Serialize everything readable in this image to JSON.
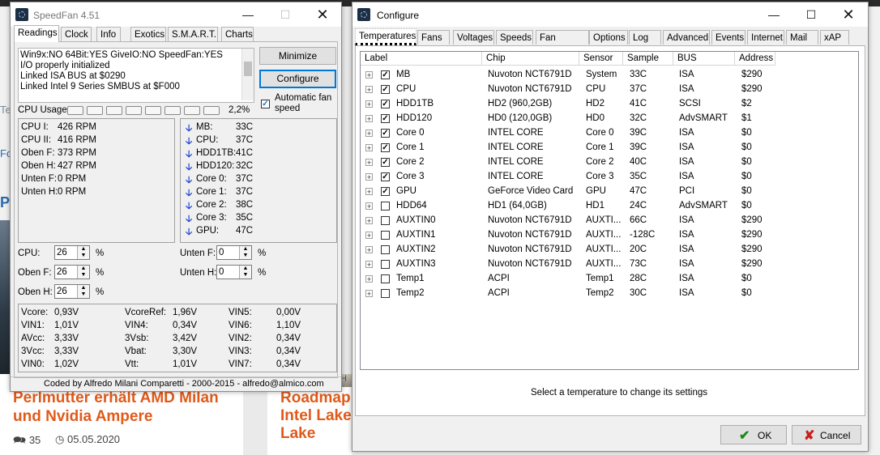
{
  "background_page": {
    "article1": {
      "title_line1": "Perlmutter erhält AMD Milan",
      "title_line2": "und Nvidia Ampere",
      "comments": "35",
      "date": "05.05.2020"
    },
    "article2": {
      "title_line1": "Roadmap",
      "title_line2": "Intel Lake",
      "title_line3": "Lake"
    },
    "misc": {
      "fo": "Fo",
      "te": "Te",
      "p": "P",
      "h": "H"
    }
  },
  "speedfan": {
    "title": "SpeedFan 4.51",
    "tabs": [
      "Readings",
      "Clock",
      "Info",
      "Exotics",
      "S.M.A.R.T.",
      "Charts"
    ],
    "active_tab": "Readings",
    "log_lines": [
      "Win9x:NO  64Bit:YES  GiveIO:NO  SpeedFan:YES",
      "I/O properly initialized",
      "Linked ISA BUS at $0290",
      "Linked Intel 9 Series SMBUS at $F000"
    ],
    "minimize_label": "Minimize",
    "configure_label": "Configure",
    "auto_fan_label": "Automatic fan speed",
    "auto_fan_checked": true,
    "cpu_usage_label": "CPU Usage",
    "cpu_usage_value": "2,2%",
    "fans": [
      {
        "label": "CPU I:",
        "value": "426 RPM"
      },
      {
        "label": "CPU II:",
        "value": "416 RPM"
      },
      {
        "label": "Oben F:",
        "value": "373 RPM"
      },
      {
        "label": "Oben H:",
        "value": "427 RPM"
      },
      {
        "label": "Unten F:",
        "value": "0 RPM"
      },
      {
        "label": "Unten H:",
        "value": "0 RPM"
      }
    ],
    "temps": [
      {
        "label": "MB:",
        "value": "33C"
      },
      {
        "label": "CPU:",
        "value": "37C"
      },
      {
        "label": "HDD1TB:",
        "value": "41C"
      },
      {
        "label": "HDD120:",
        "value": "32C"
      },
      {
        "label": "Core 0:",
        "value": "37C"
      },
      {
        "label": "Core 1:",
        "value": "37C"
      },
      {
        "label": "Core 2:",
        "value": "38C"
      },
      {
        "label": "Core 3:",
        "value": "35C"
      },
      {
        "label": "GPU:",
        "value": "47C"
      }
    ],
    "speeds_left": [
      {
        "label": "CPU:",
        "value": "26"
      },
      {
        "label": "Oben F:",
        "value": "26"
      },
      {
        "label": "Oben H:",
        "value": "26"
      }
    ],
    "speeds_right": [
      {
        "label": "Unten F:",
        "value": "0"
      },
      {
        "label": "Unten H:",
        "value": "0"
      }
    ],
    "percent": "%",
    "voltages_col1": [
      {
        "label": "Vcore:",
        "value": "0,93V"
      },
      {
        "label": "VIN1:",
        "value": "1,01V"
      },
      {
        "label": "AVcc:",
        "value": "3,33V"
      },
      {
        "label": "3Vcc:",
        "value": "3,33V"
      },
      {
        "label": "VIN0:",
        "value": "1,02V"
      }
    ],
    "voltages_col2": [
      {
        "label": "VcoreRef:",
        "value": "1,96V"
      },
      {
        "label": "VIN4:",
        "value": "0,34V"
      },
      {
        "label": "3Vsb:",
        "value": "3,42V"
      },
      {
        "label": "Vbat:",
        "value": "3,30V"
      },
      {
        "label": "Vtt:",
        "value": "1,01V"
      }
    ],
    "voltages_col3": [
      {
        "label": "VIN5:",
        "value": "0,00V"
      },
      {
        "label": "VIN6:",
        "value": "1,10V"
      },
      {
        "label": "VIN2:",
        "value": "0,34V"
      },
      {
        "label": "VIN3:",
        "value": "0,34V"
      },
      {
        "label": "VIN7:",
        "value": "0,34V"
      }
    ],
    "footer": "Coded by Alfredo Milani Comparetti - 2000-2015 - alfredo@almico.com"
  },
  "configure": {
    "title": "Configure",
    "tabs": [
      "Temperatures",
      "Fans",
      "Voltages",
      "Speeds",
      "Fan Control",
      "Options",
      "Log",
      "Advanced",
      "Events",
      "Internet",
      "Mail",
      "xAP"
    ],
    "active_tab": "Temperatures",
    "columns": [
      "Label",
      "Chip",
      "Sensor",
      "Sample",
      "BUS",
      "Address"
    ],
    "rows": [
      {
        "checked": true,
        "label": "MB",
        "chip": "Nuvoton NCT6791D",
        "sensor": "System",
        "sample": "33C",
        "bus": "ISA",
        "address": "$290"
      },
      {
        "checked": true,
        "label": "CPU",
        "chip": "Nuvoton NCT6791D",
        "sensor": "CPU",
        "sample": "37C",
        "bus": "ISA",
        "address": "$290"
      },
      {
        "checked": true,
        "label": "HDD1TB",
        "chip": "HD2 (960,2GB)",
        "sensor": "HD2",
        "sample": "41C",
        "bus": "SCSI",
        "address": "$2"
      },
      {
        "checked": true,
        "label": "HDD120",
        "chip": "HD0 (120,0GB)",
        "sensor": "HD0",
        "sample": "32C",
        "bus": "AdvSMART",
        "address": "$1"
      },
      {
        "checked": true,
        "label": "Core 0",
        "chip": "INTEL CORE",
        "sensor": "Core 0",
        "sample": "39C",
        "bus": "ISA",
        "address": "$0"
      },
      {
        "checked": true,
        "label": "Core 1",
        "chip": "INTEL CORE",
        "sensor": "Core 1",
        "sample": "39C",
        "bus": "ISA",
        "address": "$0"
      },
      {
        "checked": true,
        "label": "Core 2",
        "chip": "INTEL CORE",
        "sensor": "Core 2",
        "sample": "40C",
        "bus": "ISA",
        "address": "$0"
      },
      {
        "checked": true,
        "label": "Core 3",
        "chip": "INTEL CORE",
        "sensor": "Core 3",
        "sample": "35C",
        "bus": "ISA",
        "address": "$0"
      },
      {
        "checked": true,
        "label": "GPU",
        "chip": "GeForce Video Card",
        "sensor": "GPU",
        "sample": "47C",
        "bus": "PCI",
        "address": "$0"
      },
      {
        "checked": false,
        "label": "HDD64",
        "chip": "HD1 (64,0GB)",
        "sensor": "HD1",
        "sample": "24C",
        "bus": "AdvSMART",
        "address": "$0"
      },
      {
        "checked": false,
        "label": "AUXTIN0",
        "chip": "Nuvoton NCT6791D",
        "sensor": "AUXTI...",
        "sample": "66C",
        "bus": "ISA",
        "address": "$290"
      },
      {
        "checked": false,
        "label": "AUXTIN1",
        "chip": "Nuvoton NCT6791D",
        "sensor": "AUXTI...",
        "sample": "-128C",
        "bus": "ISA",
        "address": "$290"
      },
      {
        "checked": false,
        "label": "AUXTIN2",
        "chip": "Nuvoton NCT6791D",
        "sensor": "AUXTI...",
        "sample": "20C",
        "bus": "ISA",
        "address": "$290"
      },
      {
        "checked": false,
        "label": "AUXTIN3",
        "chip": "Nuvoton NCT6791D",
        "sensor": "AUXTI...",
        "sample": "73C",
        "bus": "ISA",
        "address": "$290"
      },
      {
        "checked": false,
        "label": "Temp1",
        "chip": "ACPI",
        "sensor": "Temp1",
        "sample": "28C",
        "bus": "ISA",
        "address": "$0"
      },
      {
        "checked": false,
        "label": "Temp2",
        "chip": "ACPI",
        "sensor": "Temp2",
        "sample": "30C",
        "bus": "ISA",
        "address": "$0"
      }
    ],
    "hint": "Select a temperature to change its settings",
    "ok_label": "OK",
    "cancel_label": "Cancel"
  }
}
